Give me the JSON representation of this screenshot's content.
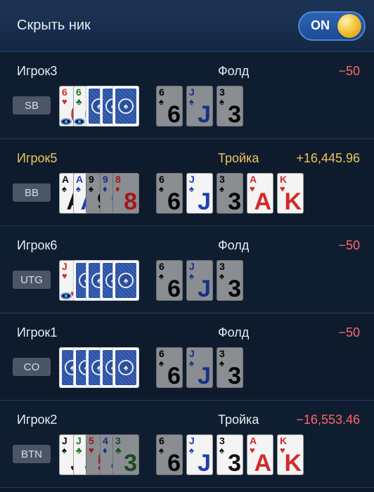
{
  "header": {
    "title": "Скрыть ник",
    "toggle_label": "ON",
    "toggle_on": true
  },
  "colors": {
    "accent_gold": "#f0c45a",
    "loss_red": "#ff6666",
    "background": "#0d1a2c"
  },
  "players": [
    {
      "name": "Игрок3",
      "position": "SB",
      "hand": "Фолд",
      "result": "−50",
      "result_type": "neg",
      "winner": false,
      "hole_cards": [
        {
          "rank": "6",
          "suit": "♥",
          "color": "red",
          "dim": false,
          "back": false
        },
        {
          "rank": "6",
          "suit": "♣",
          "color": "grn",
          "dim": false,
          "back": false
        },
        {
          "back": true
        },
        {
          "back": true
        },
        {
          "back": true
        }
      ],
      "eyes": 2,
      "board": [
        {
          "rank": "6",
          "suit": "♠",
          "color": "blk",
          "dim": true
        },
        {
          "rank": "J",
          "suit": "♠",
          "color": "blu",
          "dim": true
        },
        {
          "rank": "3",
          "suit": "♠",
          "color": "blk",
          "dim": true
        }
      ]
    },
    {
      "name": "Игрок5",
      "position": "BB",
      "hand": "Тройка",
      "result": "+16,445.96",
      "result_type": "pos",
      "winner": true,
      "hole_cards": [
        {
          "rank": "A",
          "suit": "♠",
          "color": "blk",
          "dim": false,
          "back": false
        },
        {
          "rank": "A",
          "suit": "♠",
          "color": "blu",
          "dim": false,
          "back": false
        },
        {
          "rank": "9",
          "suit": "♠",
          "color": "blk",
          "dim": true,
          "back": false
        },
        {
          "rank": "9",
          "suit": "♦",
          "color": "blu",
          "dim": true,
          "back": false
        },
        {
          "rank": "8",
          "suit": "♦",
          "color": "red",
          "dim": true,
          "back": false
        }
      ],
      "eyes": 0,
      "board": [
        {
          "rank": "6",
          "suit": "♠",
          "color": "blk",
          "dim": true
        },
        {
          "rank": "J",
          "suit": "♠",
          "color": "blu",
          "dim": false
        },
        {
          "rank": "3",
          "suit": "♠",
          "color": "blk",
          "dim": true
        },
        {
          "rank": "A",
          "suit": "♥",
          "color": "red",
          "dim": false
        },
        {
          "rank": "K",
          "suit": "♥",
          "color": "red",
          "dim": false
        }
      ]
    },
    {
      "name": "Игрок6",
      "position": "UTG",
      "hand": "Фолд",
      "result": "−50",
      "result_type": "neg",
      "winner": false,
      "hole_cards": [
        {
          "rank": "J",
          "suit": "♥",
          "color": "red",
          "dim": false,
          "back": false
        },
        {
          "back": true
        },
        {
          "back": true
        },
        {
          "back": true
        },
        {
          "back": true
        }
      ],
      "eyes": 1,
      "board": [
        {
          "rank": "6",
          "suit": "♠",
          "color": "blk",
          "dim": true
        },
        {
          "rank": "J",
          "suit": "♠",
          "color": "blu",
          "dim": true
        },
        {
          "rank": "3",
          "suit": "♠",
          "color": "blk",
          "dim": true
        }
      ]
    },
    {
      "name": "Игрок1",
      "position": "CO",
      "hand": "Фолд",
      "result": "−50",
      "result_type": "neg",
      "winner": false,
      "hole_cards": [
        {
          "back": true
        },
        {
          "back": true
        },
        {
          "back": true
        },
        {
          "back": true
        },
        {
          "back": true
        }
      ],
      "eyes": 0,
      "board": [
        {
          "rank": "6",
          "suit": "♠",
          "color": "blk",
          "dim": true
        },
        {
          "rank": "J",
          "suit": "♠",
          "color": "blu",
          "dim": true
        },
        {
          "rank": "3",
          "suit": "♠",
          "color": "blk",
          "dim": true
        }
      ]
    },
    {
      "name": "Игрок2",
      "position": "BTN",
      "hand": "Тройка",
      "result": "−16,553.46",
      "result_type": "neg",
      "winner": false,
      "hole_cards": [
        {
          "rank": "J",
          "suit": "♠",
          "color": "blk",
          "dim": false,
          "back": false
        },
        {
          "rank": "J",
          "suit": "♣",
          "color": "grn",
          "dim": false,
          "back": false
        },
        {
          "rank": "5",
          "suit": "♥",
          "color": "red",
          "dim": true,
          "back": false
        },
        {
          "rank": "4",
          "suit": "♦",
          "color": "blu",
          "dim": true,
          "back": false
        },
        {
          "rank": "3",
          "suit": "♣",
          "color": "grn",
          "dim": true,
          "back": false
        }
      ],
      "eyes": 0,
      "board": [
        {
          "rank": "6",
          "suit": "♠",
          "color": "blk",
          "dim": true
        },
        {
          "rank": "J",
          "suit": "♠",
          "color": "blu",
          "dim": false
        },
        {
          "rank": "3",
          "suit": "♠",
          "color": "blk",
          "dim": false
        },
        {
          "rank": "A",
          "suit": "♥",
          "color": "red",
          "dim": false
        },
        {
          "rank": "K",
          "suit": "♥",
          "color": "red",
          "dim": false
        }
      ]
    }
  ]
}
